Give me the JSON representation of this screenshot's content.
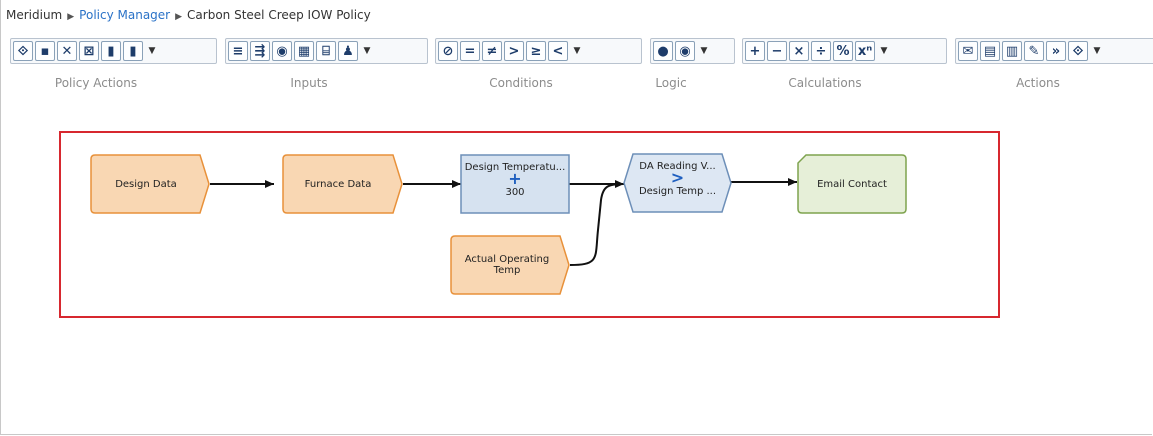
{
  "breadcrumb": {
    "root": "Meridium",
    "section": "Policy Manager",
    "page": "Carbon Steel Creep IOW Policy"
  },
  "toolbar_groups": [
    {
      "label": "Policy Actions",
      "icons": [
        "policy-icon",
        "save-icon",
        "delete-icon",
        "close-doc-icon",
        "copy-icon",
        "paste-icon"
      ]
    },
    {
      "label": "Inputs",
      "icons": [
        "list-icon",
        "query-icon",
        "point-value-icon",
        "entity-icon",
        "health-indicator-icon",
        "contact-icon"
      ]
    },
    {
      "label": "Conditions",
      "icons": [
        "is-null-icon",
        "equal-icon",
        "not-equal-icon",
        "greater-than-icon",
        "greater-equal-icon",
        "less-than-icon"
      ]
    },
    {
      "label": "Logic",
      "icons": [
        "and-icon",
        "or-icon"
      ]
    },
    {
      "label": "Calculations",
      "icons": [
        "add-icon",
        "subtract-icon",
        "multiply-icon",
        "divide-icon",
        "percent-icon",
        "power-icon"
      ]
    },
    {
      "label": "Actions",
      "icons": [
        "email-icon",
        "create-event-icon",
        "create-recommendation-icon",
        "edit-record-icon",
        "forward-icon",
        "policy-action-icon"
      ]
    }
  ],
  "toolbar_glyphs": {
    "policy-icon": "⟐",
    "save-icon": "▪",
    "delete-icon": "✕",
    "close-doc-icon": "⊠",
    "copy-icon": "▮",
    "paste-icon": "▮",
    "list-icon": "≡",
    "query-icon": "⇶",
    "point-value-icon": "◉",
    "entity-icon": "▦",
    "health-indicator-icon": "⌸",
    "contact-icon": "♟",
    "is-null-icon": "⊘",
    "equal-icon": "=",
    "not-equal-icon": "≠",
    "greater-than-icon": ">",
    "greater-equal-icon": "≥",
    "less-than-icon": "<",
    "and-icon": "●",
    "or-icon": "◉",
    "add-icon": "+",
    "subtract-icon": "−",
    "multiply-icon": "×",
    "divide-icon": "÷",
    "percent-icon": "%",
    "power-icon": "xⁿ",
    "email-icon": "✉",
    "create-event-icon": "▤",
    "create-recommendation-icon": "▥",
    "edit-record-icon": "✎",
    "forward-icon": "»",
    "policy-action-icon": "⟐"
  },
  "nodes": {
    "design_data": {
      "label": "Design Data"
    },
    "furnace_data": {
      "label": "Furnace Data"
    },
    "addition": {
      "top": "Design Temperatu...",
      "operator": "+",
      "bottom": "300"
    },
    "actual_temp": {
      "label": "Actual Operating Temp"
    },
    "comparison": {
      "top": "DA Reading V...",
      "operator": ">",
      "bottom": "Design Temp ..."
    },
    "email": {
      "label": "Email Contact"
    }
  },
  "colors": {
    "input_fill": "#f9d7b3",
    "input_border": "#e8913a",
    "calc_fill": "#d6e2f0",
    "calc_border": "#6d8fb8",
    "cond_fill": "#dde7f3",
    "cond_border": "#6d8fb8",
    "operator": "#1f5fbf",
    "action_fill": "#e6efd8",
    "action_border": "#7ea34e",
    "selection": "#d7282f"
  }
}
